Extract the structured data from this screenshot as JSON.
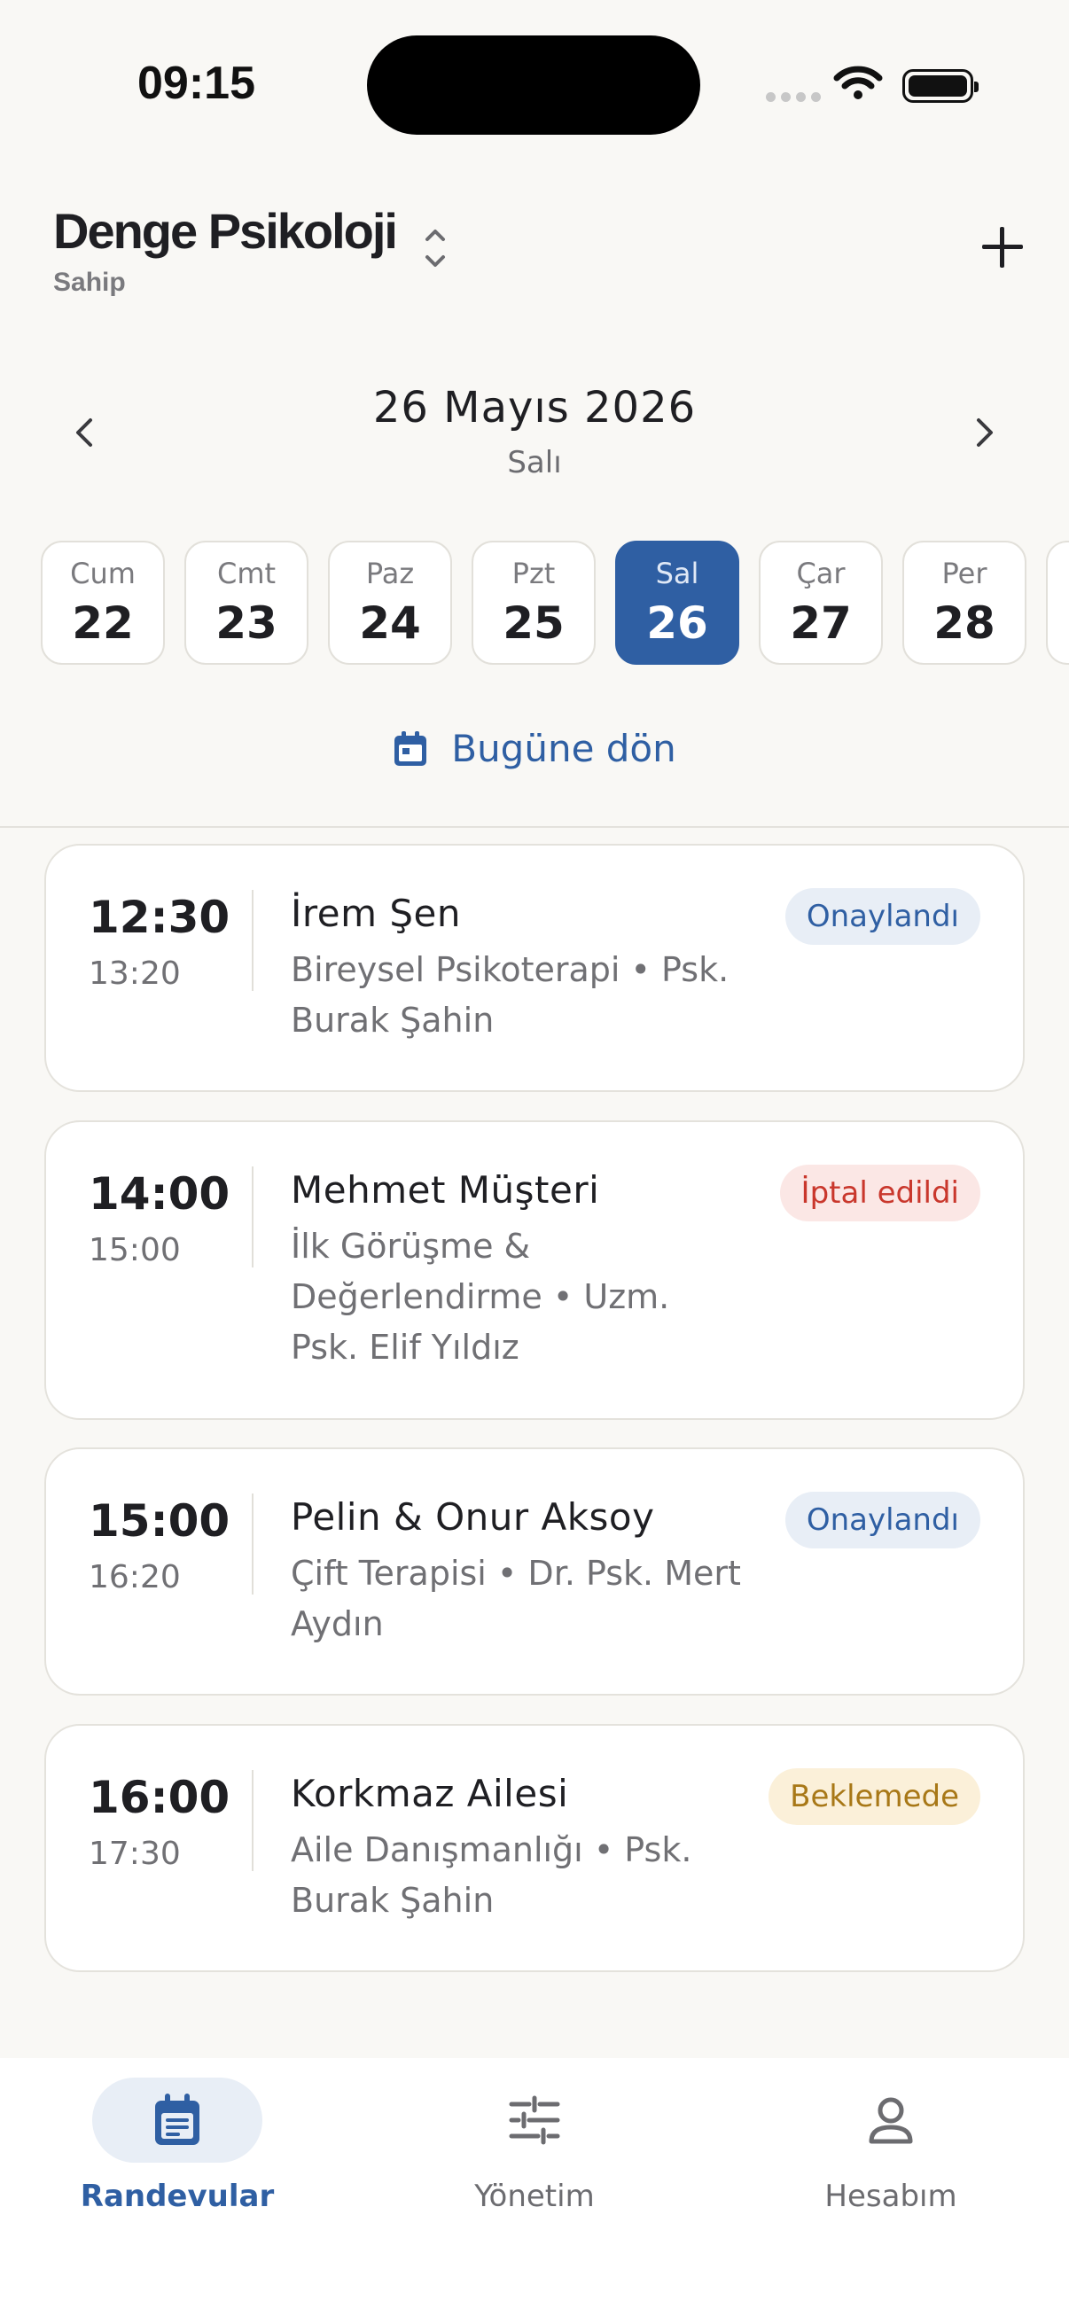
{
  "status_bar": {
    "time": "09:15"
  },
  "header": {
    "title": "Denge Psikoloji",
    "subtitle": "Sahip"
  },
  "date_nav": {
    "date": "26 Mayıs 2026",
    "weekday": "Salı"
  },
  "days": [
    {
      "name": "Cum",
      "num": "22"
    },
    {
      "name": "Cmt",
      "num": "23"
    },
    {
      "name": "Paz",
      "num": "24"
    },
    {
      "name": "Pzt",
      "num": "25"
    },
    {
      "name": "Sal",
      "num": "26",
      "selected": true
    },
    {
      "name": "Çar",
      "num": "27"
    },
    {
      "name": "Per",
      "num": "28"
    }
  ],
  "today_button": "Bugüne dön",
  "appointments": [
    {
      "start": "12:30",
      "end": "13:20",
      "client": "İrem Şen",
      "details": "Bireysel Psikoterapi • Psk. Burak Şahin",
      "status": "Onaylandı"
    },
    {
      "start": "14:00",
      "end": "15:00",
      "client": "Mehmet Müşteri",
      "details": "İlk Görüşme & Değerlendirme • Uzm. Psk. Elif Yıldız",
      "status": "İptal edildi"
    },
    {
      "start": "15:00",
      "end": "16:20",
      "client": "Pelin & Onur Aksoy",
      "details": "Çift Terapisi • Dr. Psk. Mert Aydın",
      "status": "Onaylandı"
    },
    {
      "start": "16:00",
      "end": "17:30",
      "client": "Korkmaz Ailesi",
      "details": "Aile Danışmanlığı • Psk. Burak Şahin",
      "status": "Beklemede"
    }
  ],
  "tabs": [
    {
      "label": "Randevular",
      "icon": "calendar-icon",
      "active": true
    },
    {
      "label": "Yönetim",
      "icon": "sliders-icon"
    },
    {
      "label": "Hesabım",
      "icon": "person-icon"
    }
  ],
  "colors": {
    "accent": "#2f5fa3",
    "background": "#f9f8f5",
    "confirmed": "#2f5fa3",
    "cancelled": "#c9372c",
    "pending": "#a87817"
  }
}
